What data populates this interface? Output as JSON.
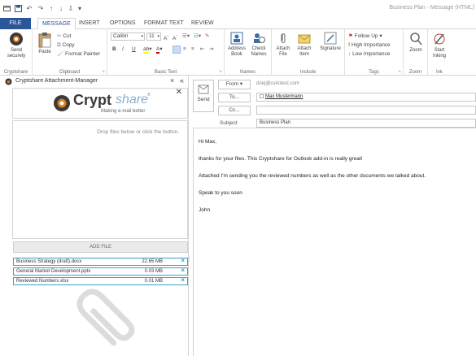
{
  "titlebar": {
    "title": "Business Plan - Message (HTML)",
    "qat": [
      "outlook-icon",
      "save-icon",
      "undo-icon",
      "redo-icon",
      "up-icon",
      "down-icon",
      "more-icon",
      "customize-icon"
    ]
  },
  "tabs": [
    "FILE",
    "MESSAGE",
    "INSERT",
    "OPTIONS",
    "FORMAT TEXT",
    "REVIEW"
  ],
  "ribbon": {
    "cryptshare": {
      "send_label": "Send securely",
      "group": "Cryptshare"
    },
    "clipboard": {
      "paste": "Paste",
      "cut": "Cut",
      "copy": "Copy",
      "format_painter": "Format Painter",
      "group": "Clipboard"
    },
    "basic_text": {
      "font": "Calibri",
      "size": "11",
      "group": "Basic Text",
      "bold": "B",
      "italic": "I",
      "underline": "U"
    },
    "names": {
      "address_book": "Address Book",
      "check_names": "Check Names",
      "group": "Names"
    },
    "include": {
      "attach_file": "Attach File",
      "attach_item": "Attach Item",
      "signature": "Signature",
      "group": "Include"
    },
    "tags": {
      "follow_up": "Follow Up",
      "high": "High Importance",
      "low": "Low Importance",
      "group": "Tags"
    },
    "zoom": {
      "zoom": "Zoom",
      "group": "Zoom"
    },
    "ink": {
      "start_inking": "Start Inking",
      "group": "Ink"
    }
  },
  "pane": {
    "title": "Cryptshare Attachment-Manager",
    "close": "×",
    "collapse": "«",
    "logo_crypt": "Crypt",
    "logo_share": "share",
    "logo_tm": "®",
    "tagline": "Making e-mail better",
    "logo_close": "✕",
    "drop_hint": "Drop files below or click the button.",
    "add_file": "ADD FILE",
    "files": [
      {
        "name": "Business Strategy (draft).docx",
        "size": "22.65 MB"
      },
      {
        "name": "General Market Development.pptx",
        "size": "0.03 MB"
      },
      {
        "name": "Reviewed Numbers.xlsx",
        "size": "0.01 MB"
      }
    ]
  },
  "compose": {
    "send": "Send",
    "from": "From",
    "from_value": "doej@cs4otest.com",
    "to": "To...",
    "to_value": "Max Mustermann",
    "cc": "Cc...",
    "subject_label": "Subject",
    "subject_value": "Business Plan",
    "body": [
      "Hi Max,",
      "thanks for your files. This Cryptshare for Outlook add-in is really great!",
      "Attached I'm sending you the reviewed numbers as well as the other documents we talked about.",
      "Speak to you soon",
      "John"
    ]
  },
  "colors": {
    "file_tab": "#2b579a",
    "accent": "#3aa0c8",
    "logo_orange": "#e07a1f"
  }
}
